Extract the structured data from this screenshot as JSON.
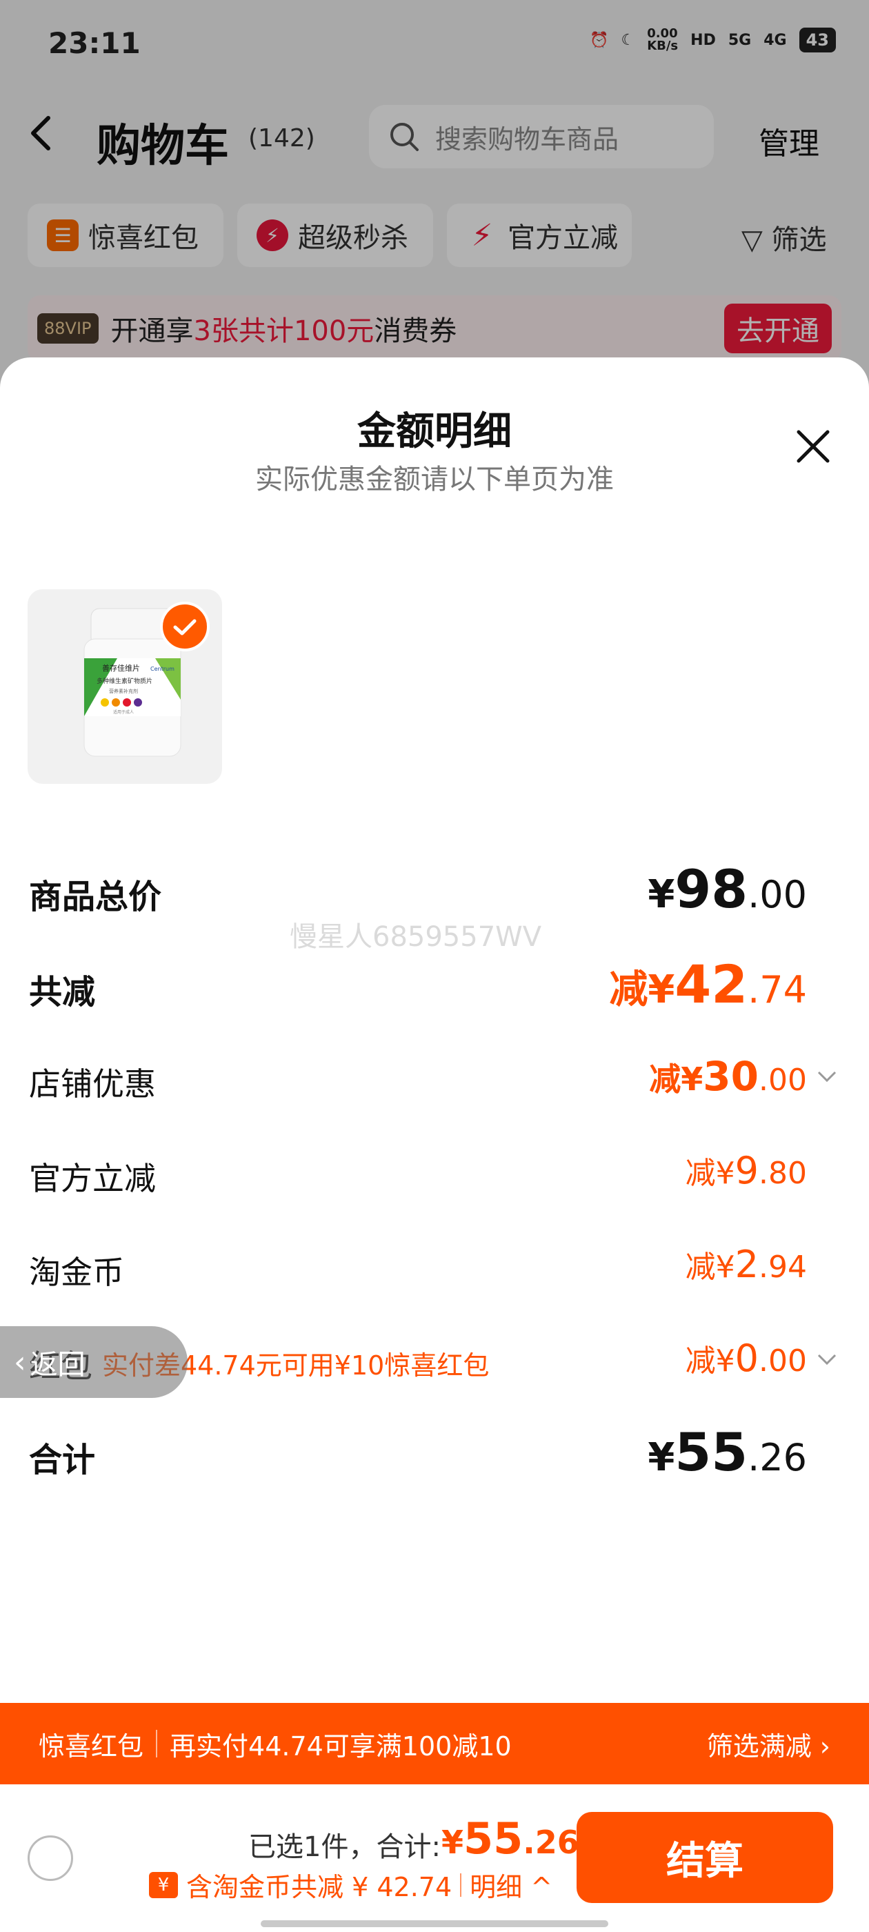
{
  "status_bar": {
    "time": "23:11",
    "net_speed": "0.00\nKB/s",
    "hd": "HD",
    "signal_1": "5G",
    "signal_2": "4G",
    "battery": "43"
  },
  "header": {
    "title": "购物车",
    "count": "(142)",
    "search_placeholder": "搜索购物车商品",
    "manage": "管理"
  },
  "chips": [
    {
      "label": "惊喜红包",
      "icon": "ticket-icon",
      "color": "#ff6a00"
    },
    {
      "label": "超级秒杀",
      "icon": "lightning-icon",
      "color": "#e8163c"
    },
    {
      "label": "官方立减",
      "icon": "bolt-icon",
      "color": "#ef1a3c"
    }
  ],
  "filter_label": "筛选",
  "vip_banner": {
    "badge": "88VIP",
    "text_pre": "开通享",
    "text_highlight": "3张共计100元",
    "text_post": "消费券",
    "button": "去开通"
  },
  "sheet": {
    "title": "金额明细",
    "subtitle": "实际优惠金额请以下单页为准",
    "product": {
      "bottle_brand": "善存佳维片",
      "bottle_name": "多种维生素矿物质片",
      "bottle_sub": "营养素补充剂",
      "bottle_note": "适用于成人",
      "bottle_logo": "Centrum"
    },
    "watermark": "慢星人6859557WV",
    "rows": {
      "goods_total": {
        "label": "商品总价",
        "currency": "¥",
        "int": "98",
        "dec": ".00"
      },
      "total_discount": {
        "label": "共减",
        "prefix": "减¥",
        "int": "42",
        "dec": ".74"
      },
      "store_discount": {
        "label": "店铺优惠",
        "prefix": "减¥",
        "int": "30",
        "dec": ".00"
      },
      "official_discount": {
        "label": "官方立减",
        "prefix": "减¥",
        "int": "9",
        "dec": ".80"
      },
      "taojinbi": {
        "label": "淘金币",
        "prefix": "减¥",
        "int": "2",
        "dec": ".94"
      },
      "hongbao": {
        "label": "红包",
        "note": "实付差44.74元可用¥10惊喜红包",
        "prefix": "减¥",
        "int": "0",
        "dec": ".00"
      },
      "sum": {
        "label": "合计",
        "currency": "¥",
        "int": "55",
        "dec": ".26"
      }
    },
    "back_pill": "返回"
  },
  "promo_bar": {
    "left": "惊喜红包",
    "middle": "再实付44.74可享满100减10",
    "right": "筛选满减 ›"
  },
  "bottom_bar": {
    "selected": "已选1件，合计:",
    "total_currency": "¥",
    "total_int": "55",
    "total_dec": ".26",
    "coin_icon": "¥",
    "coins_text": "含淘金币共减 ¥ 42.74",
    "detail": "明细 ^",
    "checkout": "结算"
  },
  "colors": {
    "accent": "#ff5000",
    "red": "#ef1a3c"
  }
}
